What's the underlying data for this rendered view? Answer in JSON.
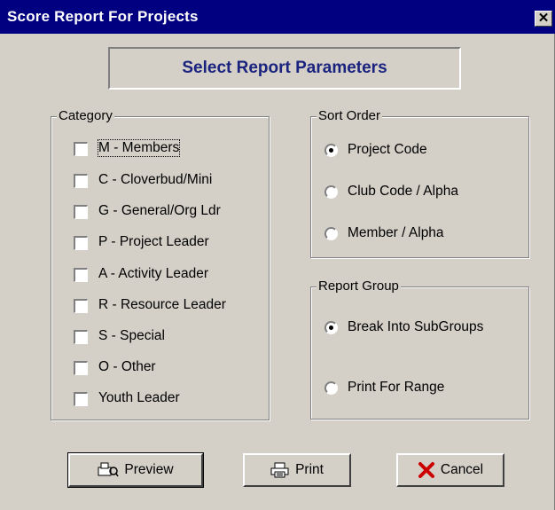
{
  "window": {
    "title": "Score Report For Projects",
    "close_glyph": "✕"
  },
  "banner": {
    "text": "Select Report Parameters"
  },
  "category": {
    "legend": "Category",
    "items": [
      {
        "label": "M - Members",
        "checked": false
      },
      {
        "label": "C - Cloverbud/Mini",
        "checked": false
      },
      {
        "label": "G - General/Org Ldr",
        "checked": false
      },
      {
        "label": "P - Project Leader",
        "checked": false
      },
      {
        "label": "A - Activity Leader",
        "checked": false
      },
      {
        "label": "R - Resource Leader",
        "checked": false
      },
      {
        "label": "S - Special",
        "checked": false
      },
      {
        "label": "O - Other",
        "checked": false
      },
      {
        "label": "Youth Leader",
        "checked": false
      }
    ]
  },
  "sort_order": {
    "legend": "Sort Order",
    "options": [
      {
        "label": "Project Code",
        "selected": true
      },
      {
        "label": "Club Code / Alpha",
        "selected": false
      },
      {
        "label": "Member / Alpha",
        "selected": false
      }
    ]
  },
  "report_group": {
    "legend": "Report Group",
    "options": [
      {
        "label": "Break Into SubGroups",
        "selected": true
      },
      {
        "label": "Print For Range",
        "selected": false
      }
    ]
  },
  "buttons": {
    "preview": {
      "label": "Preview",
      "icon": "preview-icon"
    },
    "print": {
      "label": "Print",
      "icon": "printer-icon"
    },
    "cancel": {
      "label": "Cancel",
      "icon": "red-x-icon",
      "icon_color": "#cc0000"
    }
  }
}
